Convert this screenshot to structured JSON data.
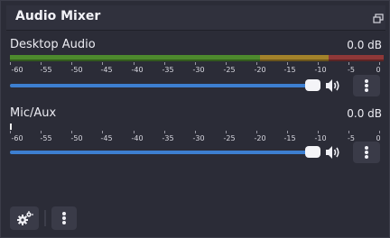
{
  "dock": {
    "title": "Audio Mixer"
  },
  "scale_labels": [
    "-60",
    "-55",
    "-50",
    "-45",
    "-40",
    "-35",
    "-30",
    "-25",
    "-20",
    "-15",
    "-10",
    "-5",
    "0"
  ],
  "channels": [
    {
      "name": "Desktop Audio",
      "level": "0.0 dB",
      "volume_fraction": 1.0
    },
    {
      "name": "Mic/Aux",
      "level": "0.0 dB",
      "volume_fraction": 1.0
    }
  ],
  "colors": {
    "meter_green": "#4f8a2e",
    "meter_yellow": "#a5832a",
    "meter_red": "#9a3a3a",
    "slider_blue": "#3d7fd0"
  },
  "icons": [
    "float-icon",
    "speaker-icon",
    "kebab-menu-icon",
    "gear-icon"
  ]
}
